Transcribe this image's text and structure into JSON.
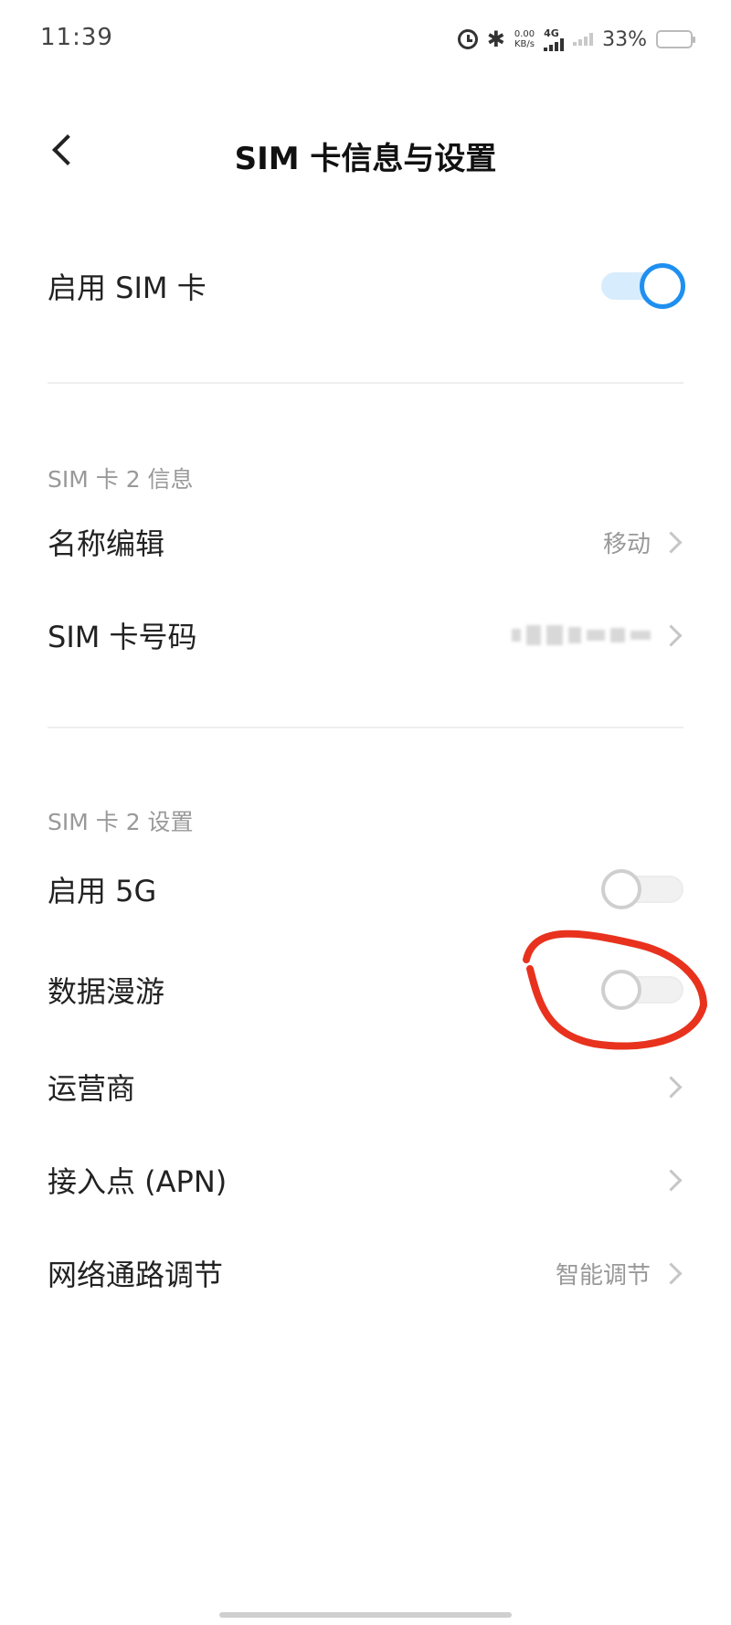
{
  "status_bar": {
    "time": "11:39",
    "net_speed_value": "0.00",
    "net_speed_unit": "KB/s",
    "network_type": "4G",
    "battery_percent": "33%",
    "battery_level": 0.33,
    "icons": [
      "alarm-icon",
      "bluetooth-icon",
      "signal-icon",
      "battery-icon"
    ]
  },
  "header": {
    "title": "SIM 卡信息与设置"
  },
  "enable_sim": {
    "label": "启用 SIM 卡",
    "enabled": true
  },
  "info_section": {
    "title": "SIM 卡 2 信息",
    "items": [
      {
        "label": "名称编辑",
        "value": "移动"
      },
      {
        "label": "SIM 卡号码",
        "value": ""
      }
    ]
  },
  "settings_section": {
    "title": "SIM 卡 2 设置",
    "toggles": [
      {
        "label": "启用 5G",
        "enabled": false
      },
      {
        "label": "数据漫游",
        "enabled": false
      }
    ],
    "items": [
      {
        "label": "运营商",
        "value": ""
      },
      {
        "label": "接入点 (APN)",
        "value": ""
      },
      {
        "label": "网络通路调节",
        "value": "智能调节"
      }
    ]
  },
  "colors": {
    "accent": "#1f8ff0",
    "annotation": "#e8321e"
  }
}
